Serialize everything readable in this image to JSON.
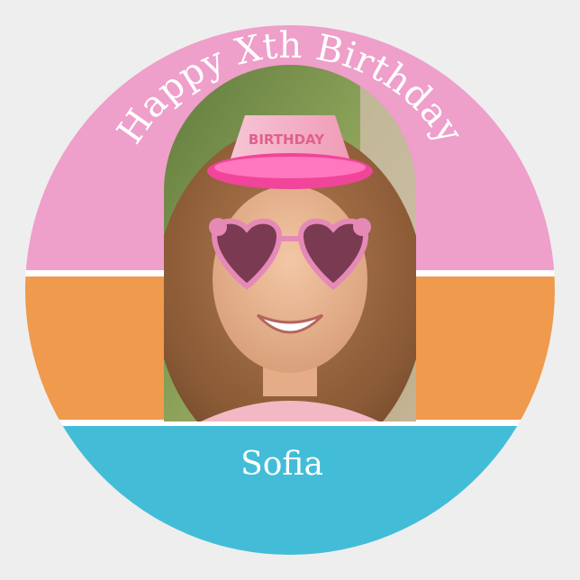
{
  "sticker": {
    "headline": "Happy Xth Birthday",
    "name": "Sofia",
    "photo": {
      "hat_text": "BIRTHDAY"
    },
    "colors": {
      "top_band": "#ee9fca",
      "middle_band": "#ef9a4c",
      "bottom_band": "#43bdd7",
      "divider": "#ffffff",
      "text": "#ffffff",
      "background": "#eeeeee"
    }
  }
}
